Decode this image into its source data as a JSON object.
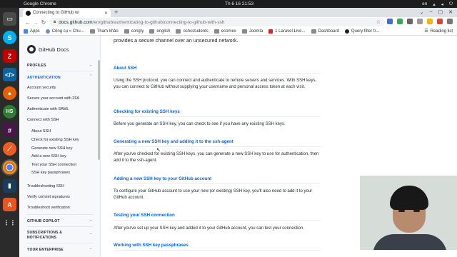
{
  "system": {
    "activities": "",
    "app_name": "Google Chrome",
    "clock": "Th 6 16  21:53",
    "lang": "en"
  },
  "browser": {
    "tab_title": "Connecting to GitHub wi",
    "url_host": "docs.github.com",
    "url_path": "/en/github/authenticating-to-github/connecting-to-github-with-ssh",
    "bookmarks": [
      "Apps",
      "Công cụ » Chu...",
      "Tham khảo",
      "congty",
      "english",
      "oshcstudents",
      "ecomex",
      "Joomla",
      "1 Laravel Live...",
      "Dashboard",
      "Query filter tr..."
    ],
    "reading_list": "Reading list"
  },
  "sidebar": {
    "logo_text": "GitHub Docs",
    "profiles": "PROFILES",
    "authentication": "AUTHENTICATION",
    "items": [
      "Account security",
      "Secure your account with 2FA",
      "Authenticate with SAML",
      "Connect with SSH"
    ],
    "sub_items": [
      "About SSH",
      "Check for existing SSH key",
      "Generate new SSH key",
      "Add a new SSH key",
      "Test your SSH connection",
      "SSH key passphrases"
    ],
    "after_items": [
      "Troubleshooting SSH",
      "Verify commit signatures",
      "Troubleshoot verification"
    ],
    "github_copilot": "GITHUB COPILOT",
    "subscriptions": "SUBSCRIPTIONS &",
    "notifications": "NOTIFICATIONS",
    "your_enterprise": "YOUR ENTERPRISE"
  },
  "content": {
    "intro": "provides a secure channel over an unsecured network.",
    "sections": [
      {
        "heading": "About SSH",
        "text": "Using the SSH protocol, you can connect and authenticate to remote servers and services. With SSH keys, you can connect to GitHub without supplying your username and personal access token at each visit."
      },
      {
        "heading": "Checking for existing SSH keys",
        "text": "Before you generate an SSH key, you can check to see if you have any existing SSH keys."
      },
      {
        "heading": "Generating a new SSH key and adding it to the ssh-agent",
        "text": "After you've checked for existing SSH keys, you can generate a new SSH key to use for authentication, then add it to the ssh-agent."
      },
      {
        "heading": "Adding a new SSH key to your GitHub account",
        "text": "To configure your GitHub account to use your new (or existing) SSH key, you'll also need to add it to your GitHub account."
      },
      {
        "heading": "Testing your SSH connection",
        "text": "After you've set up your SSH key and added it to your GitHub account, you can test your connection."
      },
      {
        "heading": "Working with SSH key passphrases",
        "text": ""
      }
    ]
  },
  "colors": {
    "link": "#0366d6",
    "sidebar_bg": "#f6f8fa",
    "dock_bg": "#2b2b2b"
  },
  "icons": {
    "dock": [
      "terminal-icon",
      "skype-icon",
      "filezilla-icon",
      "vscode-icon",
      "firefox-icon",
      "hs-icon",
      "slack-icon",
      "postman-icon",
      "chrome-icon",
      "terminal2-icon",
      "ubuntu-store-icon",
      "apps-grid-icon"
    ]
  }
}
